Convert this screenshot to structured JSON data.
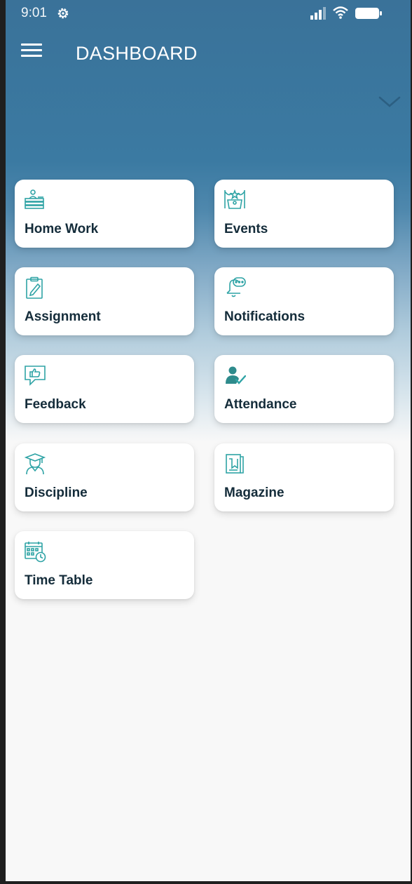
{
  "status_bar": {
    "time": "9:01",
    "icons": [
      "settings-gear-icon",
      "signal-icon",
      "wifi-icon",
      "battery-icon"
    ]
  },
  "app_bar": {
    "title": "DASHBOARD",
    "menu_icon": "hamburger-menu-icon",
    "expand_icon": "chevron-down-icon"
  },
  "colors": {
    "header_blue": "#3b7aa2",
    "icon_teal": "#2ea3a5",
    "label_text": "#142c3a",
    "card_bg": "#ffffff",
    "page_bg": "#f8f8f8"
  },
  "tiles": [
    {
      "label": "Home Work",
      "icon": "homework-desk-icon"
    },
    {
      "label": "Events",
      "icon": "events-stage-icon"
    },
    {
      "label": "Assignment",
      "icon": "assignment-clipboard-icon"
    },
    {
      "label": "Notifications",
      "icon": "notification-bell-icon"
    },
    {
      "label": "Feedback",
      "icon": "feedback-thumbs-up-icon"
    },
    {
      "label": "Attendance",
      "icon": "attendance-check-icon"
    },
    {
      "label": "Discipline",
      "icon": "discipline-graduate-icon"
    },
    {
      "label": "Magazine",
      "icon": "magazine-book-icon"
    },
    {
      "label": "Time Table",
      "icon": "timetable-calendar-icon"
    }
  ]
}
